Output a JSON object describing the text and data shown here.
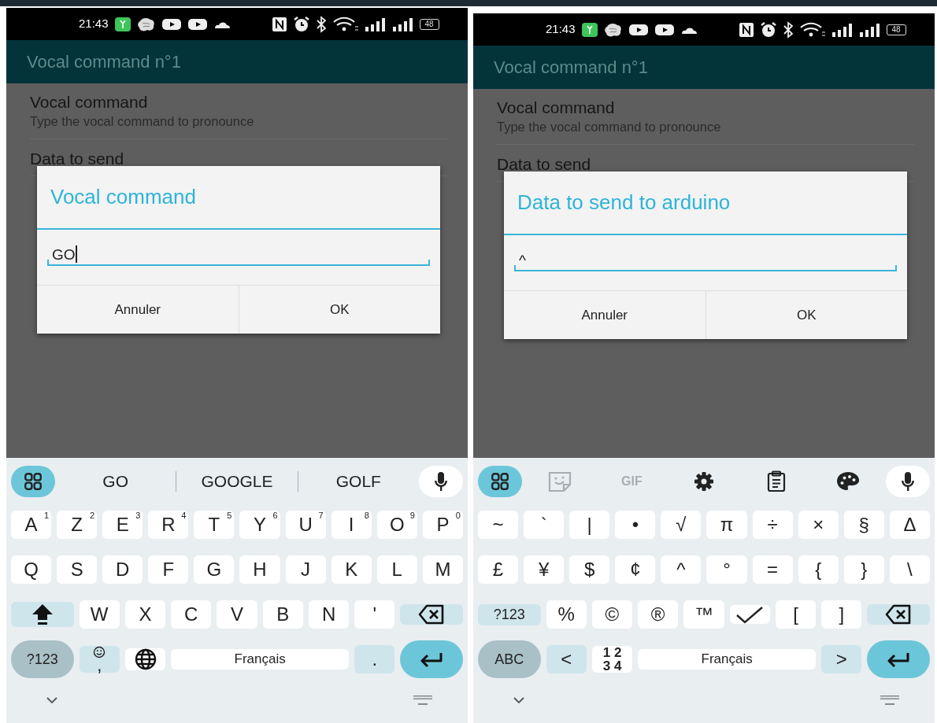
{
  "phones": [
    {
      "status_bar": {
        "time": "21:43",
        "battery": "48"
      },
      "app_bar": {
        "title": "Vocal command n°1"
      },
      "preferences": [
        {
          "title": "Vocal command",
          "summary": "Type the vocal command to pronounce"
        },
        {
          "title": "Data to send"
        }
      ],
      "dialog": {
        "title": "Vocal command",
        "value": "GO",
        "cursor_visible": true,
        "buttons": [
          "Annuler",
          "OK"
        ]
      },
      "keyboard": {
        "toolbar": [
          {
            "kind": "apps"
          },
          {
            "kind": "suggestion",
            "label": "GO"
          },
          {
            "kind": "suggestion",
            "label": "GOOGLE"
          },
          {
            "kind": "suggestion",
            "label": "GOLF"
          },
          {
            "kind": "mic"
          }
        ],
        "key_rows": [
          {
            "keys": [
              {
                "kind": "char",
                "label": "A",
                "hint": "1"
              },
              {
                "kind": "char",
                "label": "Z",
                "hint": "2"
              },
              {
                "kind": "char",
                "label": "E",
                "hint": "3"
              },
              {
                "kind": "char",
                "label": "R",
                "hint": "4"
              },
              {
                "kind": "char",
                "label": "T",
                "hint": "5"
              },
              {
                "kind": "char",
                "label": "Y",
                "hint": "6"
              },
              {
                "kind": "char",
                "label": "U",
                "hint": "7"
              },
              {
                "kind": "char",
                "label": "I",
                "hint": "8"
              },
              {
                "kind": "char",
                "label": "O",
                "hint": "9"
              },
              {
                "kind": "char",
                "label": "P",
                "hint": "0"
              }
            ]
          },
          {
            "keys": [
              {
                "kind": "char",
                "label": "Q"
              },
              {
                "kind": "char",
                "label": "S"
              },
              {
                "kind": "char",
                "label": "D"
              },
              {
                "kind": "char",
                "label": "F"
              },
              {
                "kind": "char",
                "label": "G"
              },
              {
                "kind": "char",
                "label": "H"
              },
              {
                "kind": "char",
                "label": "J"
              },
              {
                "kind": "char",
                "label": "K"
              },
              {
                "kind": "char",
                "label": "L"
              },
              {
                "kind": "char",
                "label": "M"
              }
            ]
          },
          {
            "keys": [
              {
                "kind": "shift"
              },
              {
                "kind": "char",
                "label": "W"
              },
              {
                "kind": "char",
                "label": "X"
              },
              {
                "kind": "char",
                "label": "C"
              },
              {
                "kind": "char",
                "label": "V"
              },
              {
                "kind": "char",
                "label": "B"
              },
              {
                "kind": "char",
                "label": "N"
              },
              {
                "kind": "char",
                "label": "'"
              },
              {
                "kind": "backspace"
              }
            ]
          },
          {
            "keys": [
              {
                "kind": "mode",
                "label": "?123"
              },
              {
                "kind": "emoji",
                "label": ","
              },
              {
                "kind": "globe"
              },
              {
                "kind": "space",
                "label": "Français"
              },
              {
                "kind": "func",
                "label": "."
              },
              {
                "kind": "enter"
              }
            ]
          }
        ]
      }
    },
    {
      "status_bar": {
        "time": "21:43",
        "battery": "48"
      },
      "app_bar": {
        "title": "Vocal command n°1"
      },
      "preferences": [
        {
          "title": "Vocal command",
          "summary": "Type the vocal command to pronounce"
        },
        {
          "title": "Data to send"
        }
      ],
      "dialog": {
        "title": "Data to send to arduino",
        "value": "^",
        "cursor_visible": false,
        "buttons": [
          "Annuler",
          "OK"
        ]
      },
      "keyboard": {
        "toolbar": [
          {
            "kind": "apps"
          },
          {
            "kind": "sticker"
          },
          {
            "kind": "gif",
            "label": "GIF"
          },
          {
            "kind": "settings"
          },
          {
            "kind": "clipboard"
          },
          {
            "kind": "palette"
          },
          {
            "kind": "mic"
          }
        ],
        "key_rows": [
          {
            "keys": [
              {
                "kind": "char",
                "label": "~"
              },
              {
                "kind": "char",
                "label": "`"
              },
              {
                "kind": "char",
                "label": "|"
              },
              {
                "kind": "char",
                "label": "•"
              },
              {
                "kind": "char",
                "label": "√"
              },
              {
                "kind": "char",
                "label": "π"
              },
              {
                "kind": "char",
                "label": "÷"
              },
              {
                "kind": "char",
                "label": "×"
              },
              {
                "kind": "char",
                "label": "§"
              },
              {
                "kind": "char",
                "label": "Δ"
              }
            ]
          },
          {
            "keys": [
              {
                "kind": "char",
                "label": "£"
              },
              {
                "kind": "char",
                "label": "¥"
              },
              {
                "kind": "char",
                "label": "$"
              },
              {
                "kind": "char",
                "label": "¢"
              },
              {
                "kind": "char",
                "label": "^"
              },
              {
                "kind": "char",
                "label": "°"
              },
              {
                "kind": "char",
                "label": "="
              },
              {
                "kind": "char",
                "label": "{"
              },
              {
                "kind": "char",
                "label": "}"
              },
              {
                "kind": "char",
                "label": "\\"
              }
            ]
          },
          {
            "keys": [
              {
                "kind": "func-wide",
                "label": "?123"
              },
              {
                "kind": "char",
                "label": "%"
              },
              {
                "kind": "char",
                "label": "©"
              },
              {
                "kind": "char",
                "label": "®"
              },
              {
                "kind": "char",
                "label": "™"
              },
              {
                "kind": "check"
              },
              {
                "kind": "char",
                "label": "["
              },
              {
                "kind": "char",
                "label": "]"
              },
              {
                "kind": "backspace"
              }
            ]
          },
          {
            "keys": [
              {
                "kind": "mode",
                "label": "ABC"
              },
              {
                "kind": "func",
                "label": "<"
              },
              {
                "kind": "stack",
                "lines": [
                  "1 2",
                  "3 4"
                ]
              },
              {
                "kind": "space",
                "label": "Français"
              },
              {
                "kind": "func",
                "label": ">"
              },
              {
                "kind": "enter"
              }
            ]
          }
        ]
      }
    }
  ]
}
